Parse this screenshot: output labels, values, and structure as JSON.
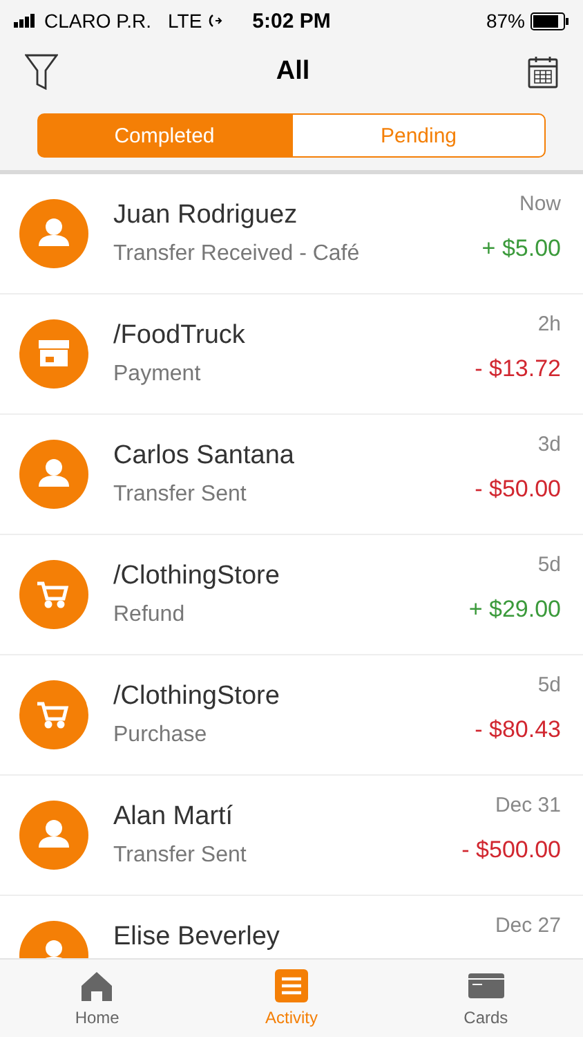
{
  "status_bar": {
    "carrier": "CLARO P.R.",
    "network": "LTE",
    "time": "5:02 PM",
    "battery": "87%"
  },
  "header": {
    "title": "All"
  },
  "segments": [
    {
      "label": "Completed",
      "selected": true
    },
    {
      "label": "Pending",
      "selected": false
    }
  ],
  "transactions": [
    {
      "kind": "person",
      "name": "Juan Rodriguez",
      "description": "Transfer Received - Café",
      "time": "Now",
      "amount": "+ $5.00",
      "color": "#3b9a3b"
    },
    {
      "kind": "store",
      "name": "/FoodTruck",
      "description": "Payment",
      "time": "2h",
      "amount": "- $13.72",
      "color": "#d1262f"
    },
    {
      "kind": "person",
      "name": "Carlos Santana",
      "description": "Transfer Sent",
      "time": "3d",
      "amount": "- $50.00",
      "color": "#d1262f"
    },
    {
      "kind": "cart",
      "name": "/ClothingStore",
      "description": "Refund",
      "time": "5d",
      "amount": "+ $29.00",
      "color": "#3b9a3b"
    },
    {
      "kind": "cart",
      "name": "/ClothingStore",
      "description": "Purchase",
      "time": "5d",
      "amount": "- $80.43",
      "color": "#d1262f"
    },
    {
      "kind": "person",
      "name": "Alan Martí",
      "description": "Transfer Sent",
      "time": "Dec 31",
      "amount": "- $500.00",
      "color": "#d1262f"
    },
    {
      "kind": "person",
      "name": "Elise Beverley",
      "time": "Dec 27"
    }
  ],
  "tab_bar": [
    {
      "kind": "home",
      "label": "Home",
      "selected": false
    },
    {
      "kind": "activity",
      "label": "Activity",
      "selected": true
    },
    {
      "kind": "cards",
      "label": "Cards",
      "selected": false
    }
  ]
}
